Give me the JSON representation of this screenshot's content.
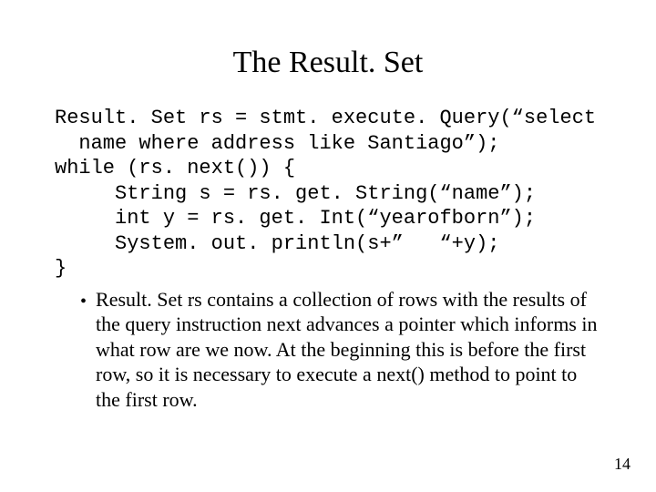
{
  "title": "The Result. Set",
  "code": "Result. Set rs = stmt. execute. Query(“select\n  name where address like Santiago”);\nwhile (rs. next()) {\n     String s = rs. get. String(“name”);\n     int y = rs. get. Int(“yearofborn”);\n     System. out. println(s+”   “+y);\n}",
  "bullet": "Result. Set rs contains a collection of rows with the results of the query instruction next advances a pointer which informs in what row are we now. At the beginning this is before the first row, so it is necessary to execute a next() method to point to the first row.",
  "page_number": "14"
}
